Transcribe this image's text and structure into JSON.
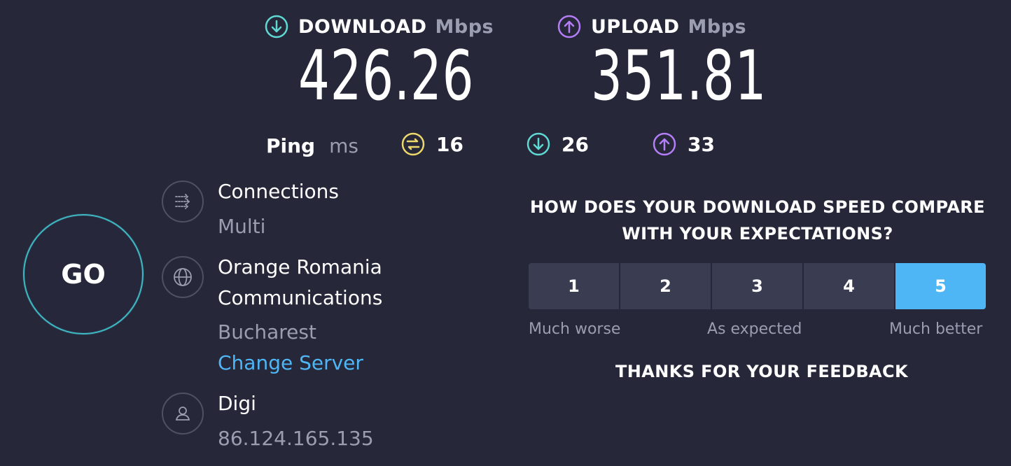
{
  "download": {
    "label": "DOWNLOAD",
    "unit": "Mbps",
    "value": "426.26",
    "icon": "arrow-down-circle-icon",
    "color": "#5fd9d3"
  },
  "upload": {
    "label": "UPLOAD",
    "unit": "Mbps",
    "value": "351.81",
    "icon": "arrow-up-circle-icon",
    "color": "#b47ef7"
  },
  "ping": {
    "label": "Ping",
    "unit": "ms",
    "idle": {
      "value": "16",
      "icon": "ping-idle-icon",
      "color": "#ecd86b"
    },
    "download": {
      "value": "26",
      "icon": "ping-download-icon",
      "color": "#5fd9d3"
    },
    "upload": {
      "value": "33",
      "icon": "ping-upload-icon",
      "color": "#b47ef7"
    }
  },
  "go_button": {
    "label": "GO"
  },
  "connections": {
    "title": "Connections",
    "value": "Multi",
    "icon": "connections-icon"
  },
  "server": {
    "name_line1": "Orange Romania",
    "name_line2": "Communications",
    "location": "Bucharest",
    "change_link": "Change Server",
    "icon": "globe-icon"
  },
  "provider": {
    "name": "Digi",
    "ip": "86.124.165.135",
    "icon": "user-icon"
  },
  "feedback": {
    "question_line1": "HOW DOES YOUR DOWNLOAD SPEED COMPARE",
    "question_line2": "WITH YOUR EXPECTATIONS?",
    "options": [
      "1",
      "2",
      "3",
      "4",
      "5"
    ],
    "selected": "5",
    "scale_low": "Much worse",
    "scale_mid": "As expected",
    "scale_high": "Much better",
    "thanks": "THANKS FOR YOUR FEEDBACK",
    "selected_color": "#4fb6f5"
  }
}
